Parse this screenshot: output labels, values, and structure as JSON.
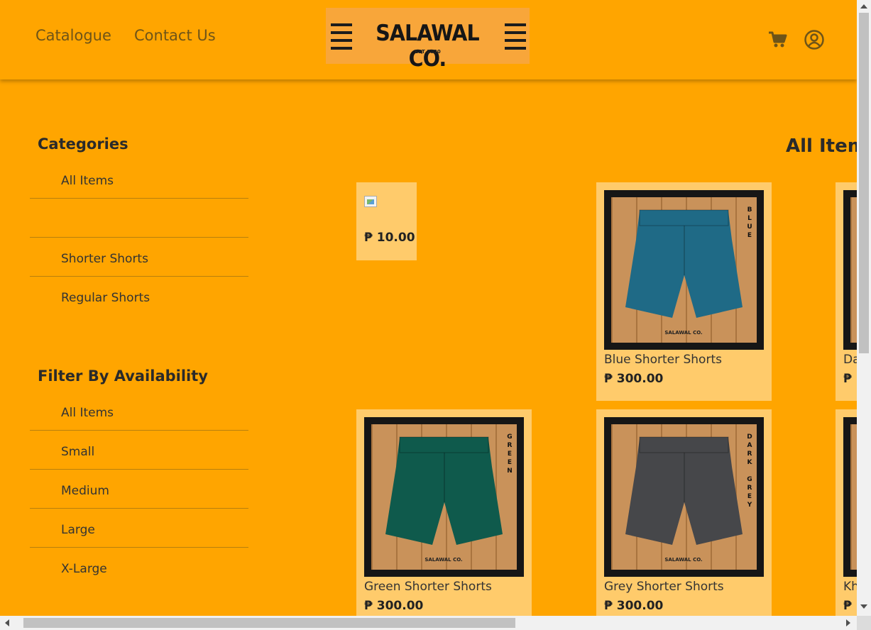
{
  "header": {
    "nav": [
      {
        "label": "Catalogue"
      },
      {
        "label": "Contact Us"
      }
    ],
    "logo": {
      "text": "SALAWAL CO.",
      "est": "EST 2020"
    },
    "cart_icon": "cart-icon",
    "account_icon": "user-circle-icon"
  },
  "sidebar": {
    "categories_heading": "Categories",
    "categories": [
      "All Items",
      "",
      "Shorter Shorts",
      "Regular Shorts"
    ],
    "availability_heading": "Filter By Availability",
    "availability": [
      "All Items",
      "Small",
      "Medium",
      "Large",
      "X-Large"
    ]
  },
  "main": {
    "title": "All Items",
    "products": [
      {
        "name": "",
        "price": "₱ 10.00",
        "broken_image": true
      },
      {
        "name": "Blue Shorter Shorts",
        "price": "₱ 300.00",
        "color": "#1f6a86",
        "label": "BLUE"
      },
      {
        "name": "Da",
        "price": "₱",
        "color": "#3b3b40",
        "label": ""
      },
      {
        "name": "Green Shorter Shorts",
        "price": "₱ 300.00",
        "color": "#0f5a4c",
        "label": "GREEN"
      },
      {
        "name": "Grey Shorter Shorts",
        "price": "₱ 300.00",
        "color": "#46474a",
        "label": "DARK GREY"
      },
      {
        "name": "Kh",
        "price": "₱",
        "color": "#9a9689",
        "label": ""
      }
    ],
    "image_brand": "SALAWAL CO."
  },
  "colors": {
    "background": "#FFA500",
    "card": "#FFCB6B",
    "text": "#333333"
  }
}
